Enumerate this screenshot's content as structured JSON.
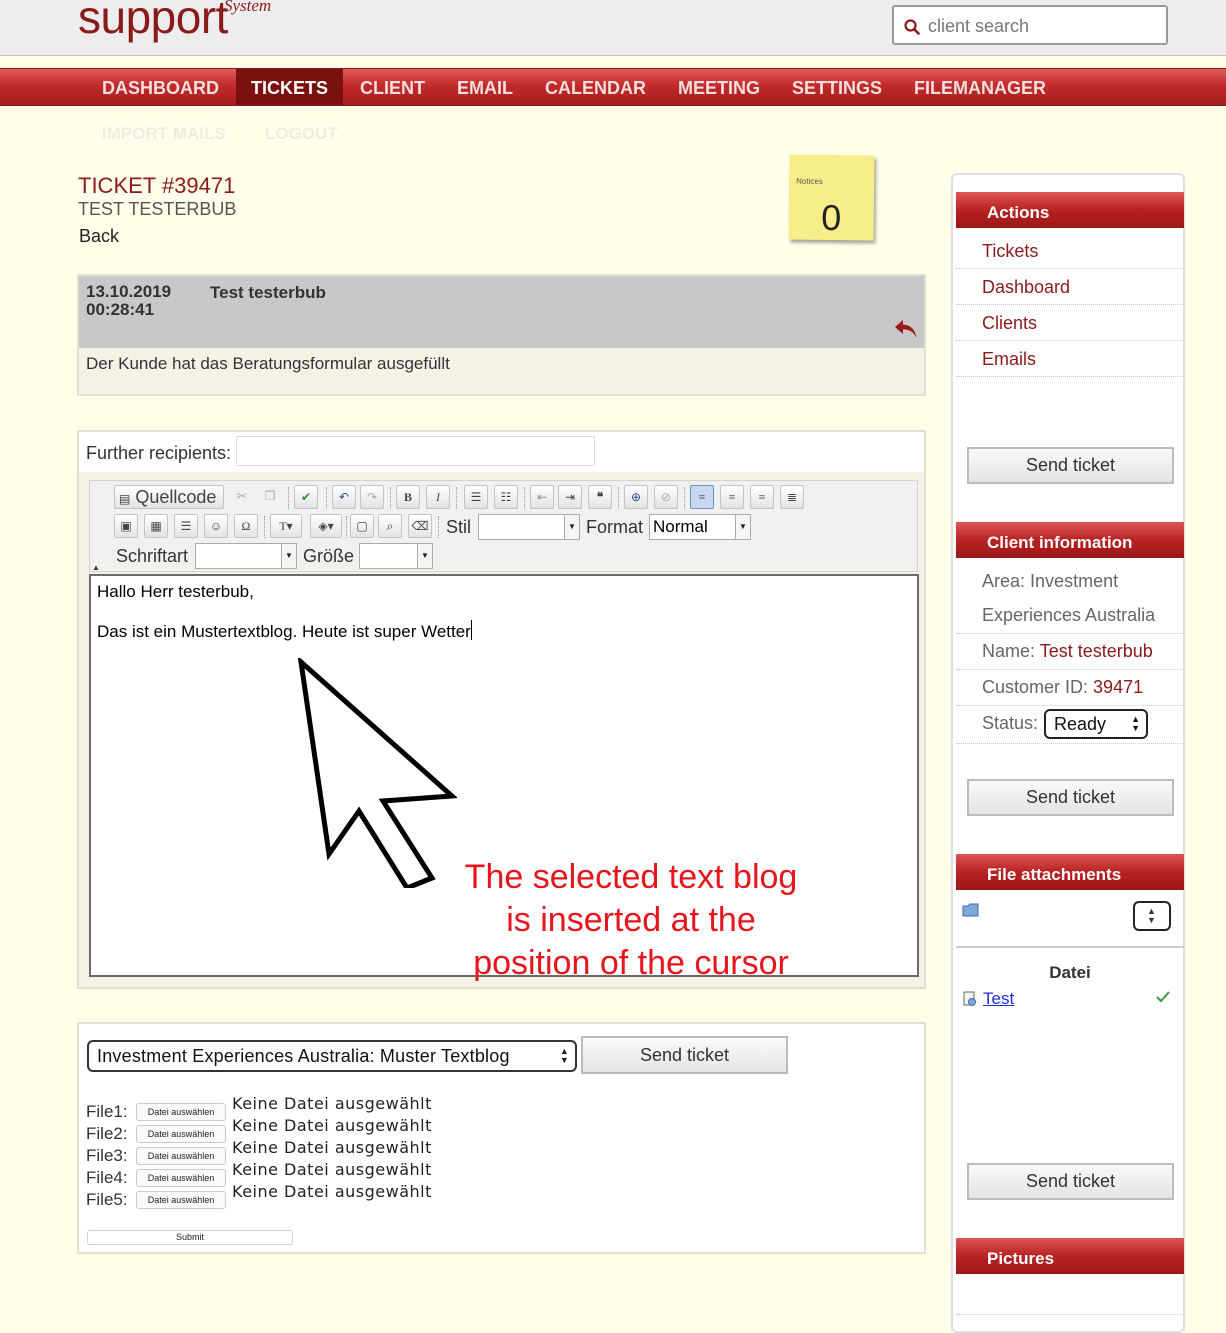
{
  "header": {
    "logo_main": "support",
    "logo_sup": "System",
    "search_placeholder": "client search"
  },
  "nav": {
    "items": [
      "DASHBOARD",
      "TICKETS",
      "CLIENT",
      "EMAIL",
      "CALENDAR",
      "MEETING",
      "SETTINGS",
      "FILEMANAGER"
    ],
    "active": "TICKETS",
    "sub_items": [
      "IMPORT MAILS",
      "LOGOUT"
    ]
  },
  "ticket": {
    "title": "TICKET #39471",
    "subtitle": "TEST TESTERBUB",
    "back_label": "Back"
  },
  "notice": {
    "label": "Notices",
    "count": "0"
  },
  "message": {
    "date": "13.10.2019",
    "time": "00:28:41",
    "author": "Test testerbub",
    "body": "Der Kunde hat das Beratungsformular ausgefüllt"
  },
  "editor": {
    "recipients_label": "Further recipients:",
    "recipients_value": "",
    "source_label": "Quellcode",
    "style_label": "Stil",
    "style_value": "",
    "format_label": "Format",
    "format_value": "Normal",
    "font_label": "Schriftart",
    "font_value": "",
    "size_label": "Größe",
    "size_value": "",
    "line1": "Hallo Herr testerbub,",
    "line2": "Das ist ein Mustertextblog. Heute ist super Wetter",
    "annotation": "The selected text blog is inserted at the position of the cursor"
  },
  "form": {
    "template_selected": "Investment Experiences Australia: Muster Textblog",
    "send_label": "Send ticket",
    "files": [
      {
        "label": "File1:",
        "button": "Datei auswählen",
        "status": "Keine Datei ausgewählt"
      },
      {
        "label": "File2:",
        "button": "Datei auswählen",
        "status": "Keine Datei ausgewählt"
      },
      {
        "label": "File3:",
        "button": "Datei auswählen",
        "status": "Keine Datei ausgewählt"
      },
      {
        "label": "File4:",
        "button": "Datei auswählen",
        "status": "Keine Datei ausgewählt"
      },
      {
        "label": "File5:",
        "button": "Datei auswählen",
        "status": "Keine Datei ausgewählt"
      }
    ],
    "submit_label": "Submit"
  },
  "sidebar": {
    "actions_title": "Actions",
    "actions": [
      "Tickets",
      "Dashboard",
      "Clients",
      "Emails"
    ],
    "send_label": "Send ticket",
    "client_title": "Client information",
    "area_label": "Area:",
    "area_value_1": "Investment",
    "area_value_2": "Experiences Australia",
    "name_label": "Name:",
    "name_value": "Test testerbub",
    "customer_id_label": "Customer ID:",
    "customer_id_value": "39471",
    "status_label": "Status:",
    "status_value": "Ready",
    "attachments_title": "File attachments",
    "datei_header": "Datei",
    "attachment_name": "Test",
    "pictures_title": "Pictures"
  },
  "colors": {
    "brand": "#8b1a1a",
    "nav_red": "#c22b2b",
    "annotation_red": "#e8141b",
    "page_bg": "#fffee9"
  }
}
